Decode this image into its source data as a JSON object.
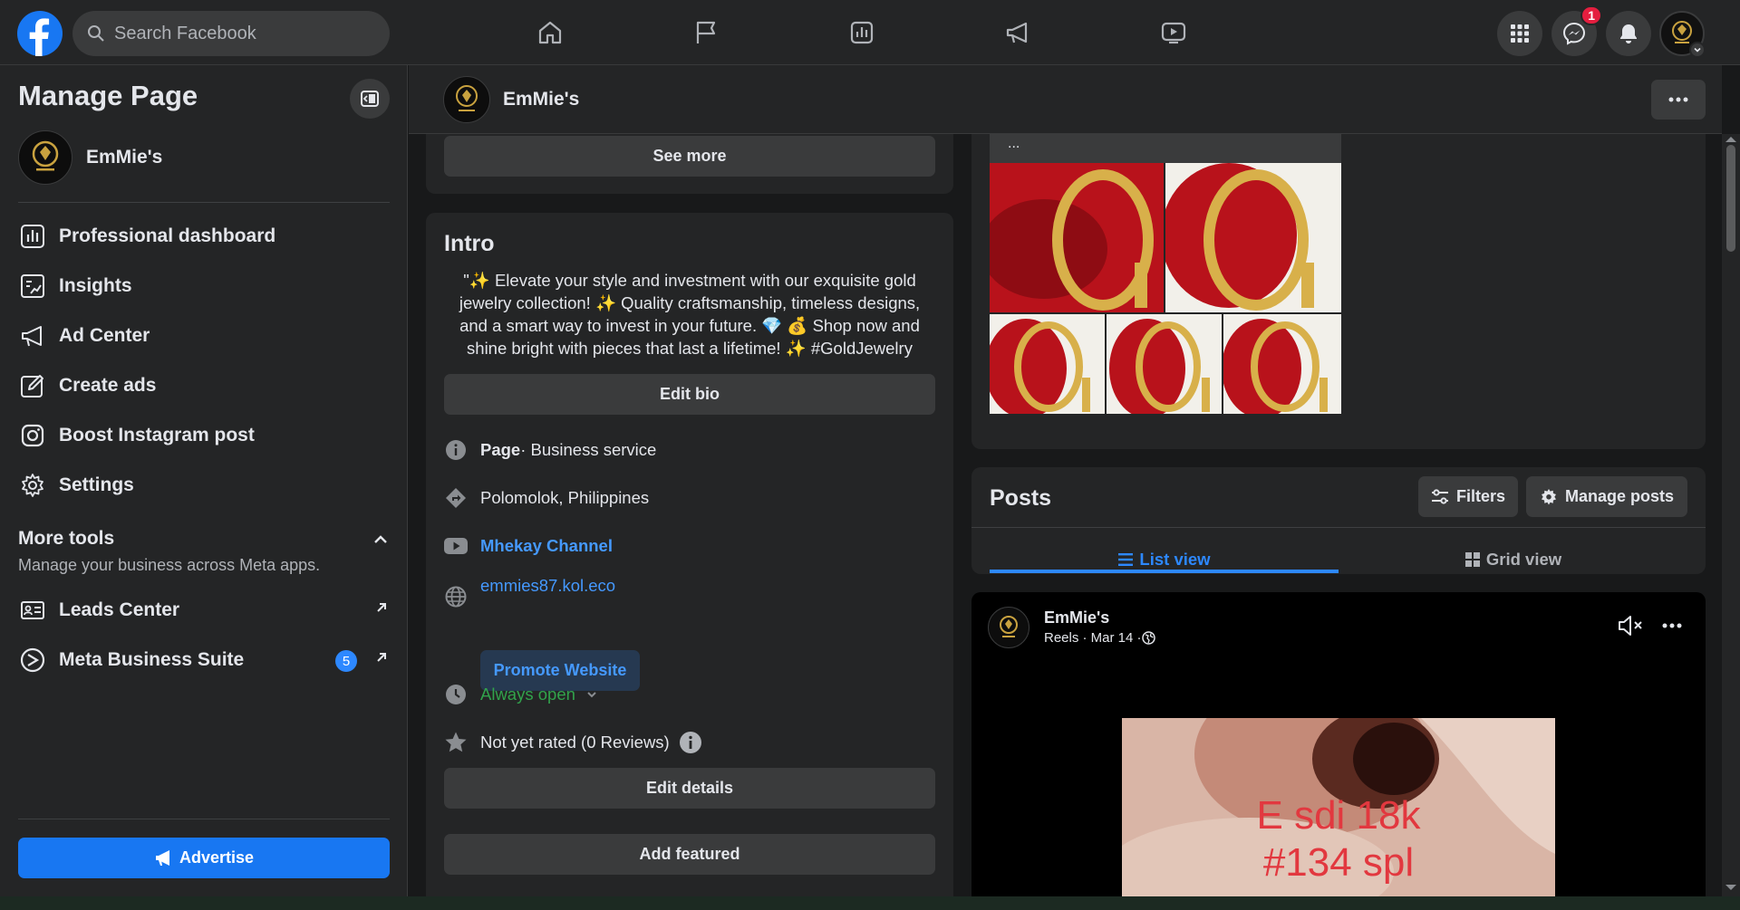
{
  "topbar": {
    "search_placeholder": "Search Facebook",
    "nav_icons": [
      "home-icon",
      "flag-icon",
      "insights-icon",
      "megaphone-icon",
      "video-icon"
    ],
    "messenger_badge": "1"
  },
  "sidebar": {
    "title": "Manage Page",
    "page_name": "EmMie's",
    "items": [
      {
        "label": "Professional dashboard",
        "icon": "dashboard-icon"
      },
      {
        "label": "Insights",
        "icon": "insights-icon"
      },
      {
        "label": "Ad Center",
        "icon": "megaphone-icon"
      },
      {
        "label": "Create ads",
        "icon": "pencil-icon"
      },
      {
        "label": "Boost Instagram post",
        "icon": "instagram-icon"
      },
      {
        "label": "Settings",
        "icon": "gear-icon"
      }
    ],
    "more_tools": {
      "title": "More tools",
      "subtitle": "Manage your business across Meta apps.",
      "items": [
        {
          "label": "Leads Center",
          "icon": "contact-card-icon"
        },
        {
          "label": "Meta Business Suite",
          "icon": "meta-suite-icon",
          "badge": "5"
        }
      ]
    },
    "advertise_label": "Advertise"
  },
  "page_header": {
    "name": "EmMie's"
  },
  "about": {
    "see_more_label": "See more"
  },
  "intro": {
    "title": "Intro",
    "bio": "\"✨ Elevate your style and investment with our exquisite gold jewelry collection! ✨ Quality craftsmanship, timeless designs, and a smart way to invest in your future. 💎 💰 Shop now and shine bright with pieces that last a lifetime! ✨ #GoldJewelry",
    "edit_bio_label": "Edit bio",
    "category_prefix": "Page",
    "category": " · Business service",
    "location": "Polomolok, Philippines",
    "youtube_channel": "Mhekay Channel",
    "website": "emmies87.kol.eco",
    "promote_website_label": "Promote Website",
    "hours": "Always open",
    "rating": "Not yet rated (0 Reviews)",
    "edit_details_label": "Edit details",
    "add_featured_label": "Add featured"
  },
  "photos": {
    "ellipsis": "...",
    "colors": {
      "red": "#b8121b",
      "gold": "#d8b04a",
      "white": "#f2f0ea"
    }
  },
  "posts": {
    "title": "Posts",
    "filters_label": "Filters",
    "manage_posts_label": "Manage posts",
    "tabs": [
      {
        "label": "List view",
        "active": true
      },
      {
        "label": "Grid view",
        "active": false
      }
    ],
    "accent_color": "#2d88ff",
    "post": {
      "author": "EmMie's",
      "meta": "Reels · Mar 14 · ",
      "overlay_line1": "E sdi 18k",
      "overlay_line2": "#134 spl"
    }
  }
}
